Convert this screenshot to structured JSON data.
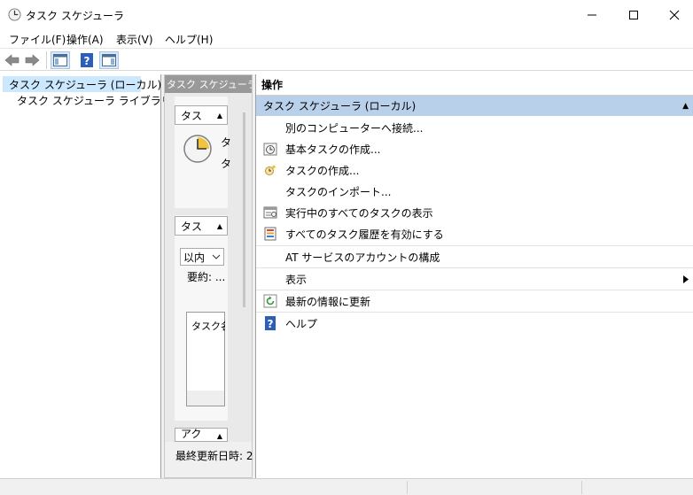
{
  "window": {
    "title": "タスク スケジューラ",
    "minimize": "—",
    "maximize": "☐",
    "close": "✕"
  },
  "menu": [
    {
      "label": "ファイル(F)"
    },
    {
      "label": "操作(A)"
    },
    {
      "label": "表示(V)"
    },
    {
      "label": "ヘルプ(H)"
    }
  ],
  "tree": {
    "root": "タスク スケジューラ (ローカル)",
    "library": "タスク スケジューラ ライブラリ"
  },
  "middle": {
    "header": "タスク スケジューラの",
    "section1_btn": "タス",
    "text_a": "タ",
    "text_b": "タ",
    "section2_btn": "タス",
    "dropdown": "以内",
    "summary": "要約: ...",
    "list_header": "タスク名",
    "section3_btn": "アク",
    "last_updated": "最終更新日時: 2"
  },
  "actions": {
    "header": "操作",
    "group": "タスク スケジューラ (ローカル)",
    "items": [
      {
        "label": "別のコンピューターへ接続...",
        "icon": "none"
      },
      {
        "label": "基本タスクの作成...",
        "icon": "basic-task-icon"
      },
      {
        "label": "タスクの作成...",
        "icon": "create-task-icon"
      },
      {
        "label": "タスクのインポート...",
        "icon": "none"
      },
      {
        "label": "実行中のすべてのタスクの表示",
        "icon": "running-tasks-icon"
      },
      {
        "label": "すべてのタスク履歴を有効にする",
        "icon": "history-icon"
      },
      {
        "label": "AT サービスのアカウントの構成",
        "icon": "none"
      },
      {
        "label": "表示",
        "icon": "none"
      },
      {
        "label": "最新の情報に更新",
        "icon": "refresh-icon"
      },
      {
        "label": "ヘルプ",
        "icon": "help-icon"
      }
    ]
  },
  "colors": {
    "group_header": "#b8d0ea",
    "tree_selected": "#cce8ff",
    "help_blue": "#2b5fb8"
  }
}
